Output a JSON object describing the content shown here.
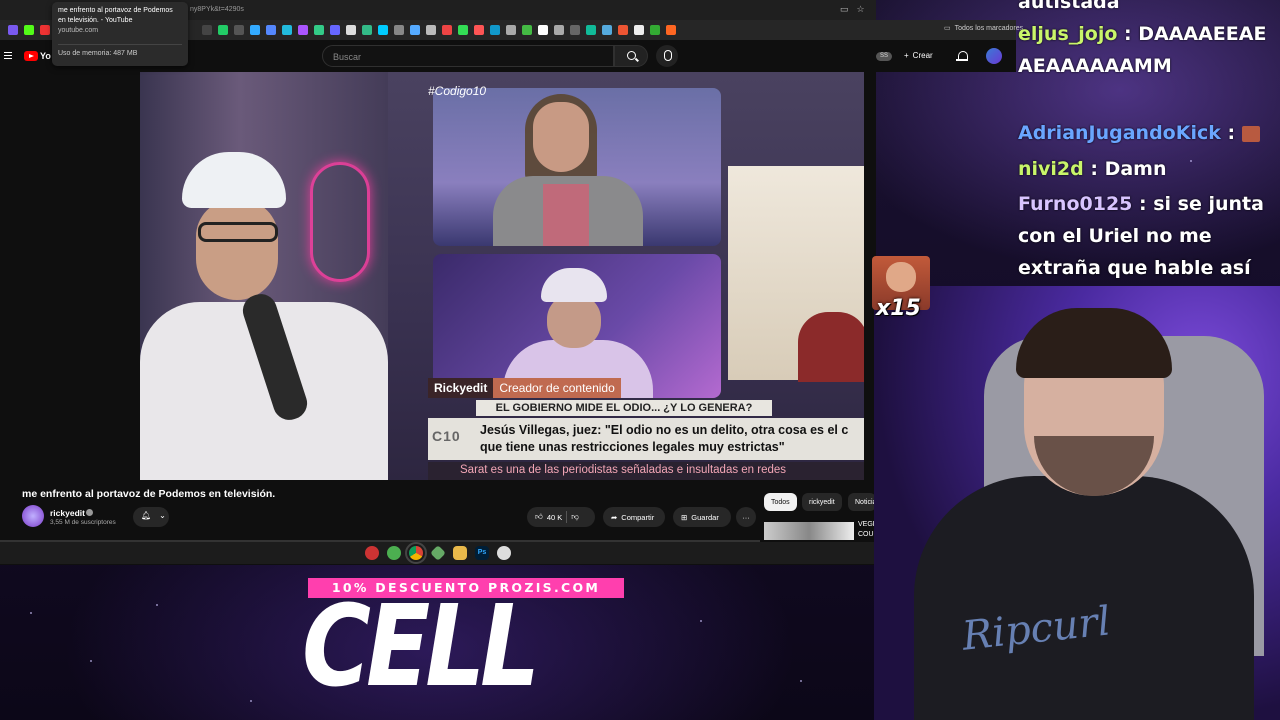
{
  "browser": {
    "tab_title": "me enfrento al portavoz de Podemos en televisión. - YouTube",
    "tab_url": "youtube.com",
    "memory_label": "Uso de memoria: 487 MB",
    "url_fragment": "ny8PYk&t=4290s",
    "bookmarks_label": "Todos los marcadores"
  },
  "youtube": {
    "logo_text": "Yo",
    "search_placeholder": "Buscar",
    "badge": "SS",
    "create_label": "Crear"
  },
  "video_overlay": {
    "hashtag": "#Codigo10",
    "name_tag": "Rickyedit",
    "role_tag": "Creador de contenido",
    "headline": "EL GOBIERNO MIDE EL ODIO... ¿Y LO GENERA?",
    "quote_logo": "C10",
    "quote_line1": "Jesús Villegas, juez: \"El odio no es un delito, otra cosa es el c",
    "quote_line2": "que tiene unas restricciones legales muy estrictas\"",
    "ticker": "Sarat es una de las periodistas señaladas e insultadas en redes"
  },
  "emote_overlay": {
    "count": "x15"
  },
  "video": {
    "title": "me enfrento al portavoz de Podemos en televisión.",
    "channel": "rickyedit",
    "subscribers": "3,55 M de suscriptores",
    "likes": "40 K",
    "share_label": "Compartir",
    "save_label": "Guardar",
    "more_label": "···"
  },
  "filters": [
    "Todos",
    "rickyedit",
    "Noticias"
  ],
  "recommendation": {
    "title": "VEGETTA COU"
  },
  "promo": {
    "banner": "10% DESCUENTO PROZIS.COM",
    "big_text": "CELL"
  },
  "chat": [
    {
      "user": "",
      "text": "autistada",
      "user_color": "#ffffff"
    },
    {
      "user": "eljus_jojo",
      "text": "DAAAAEEAEAEAAAAAAMM",
      "user_color": "#c9f56a"
    },
    {
      "user": "AdrianJugandoKick",
      "text": "",
      "user_color": "#6aa6ff"
    },
    {
      "user": "nivi2d",
      "text": "Damn",
      "user_color": "#c9f56a"
    },
    {
      "user": "Furno0125",
      "text": "si se junta con el Uriel no me extraña que hable así",
      "user_color": "#d8c4ff"
    }
  ],
  "webcam": {
    "shirt_text": "Ripcurl"
  },
  "colors": {
    "youtube_red": "#ff0000",
    "promo_pink": "#ff3fae",
    "dark_bg": "#0f0f0f"
  }
}
